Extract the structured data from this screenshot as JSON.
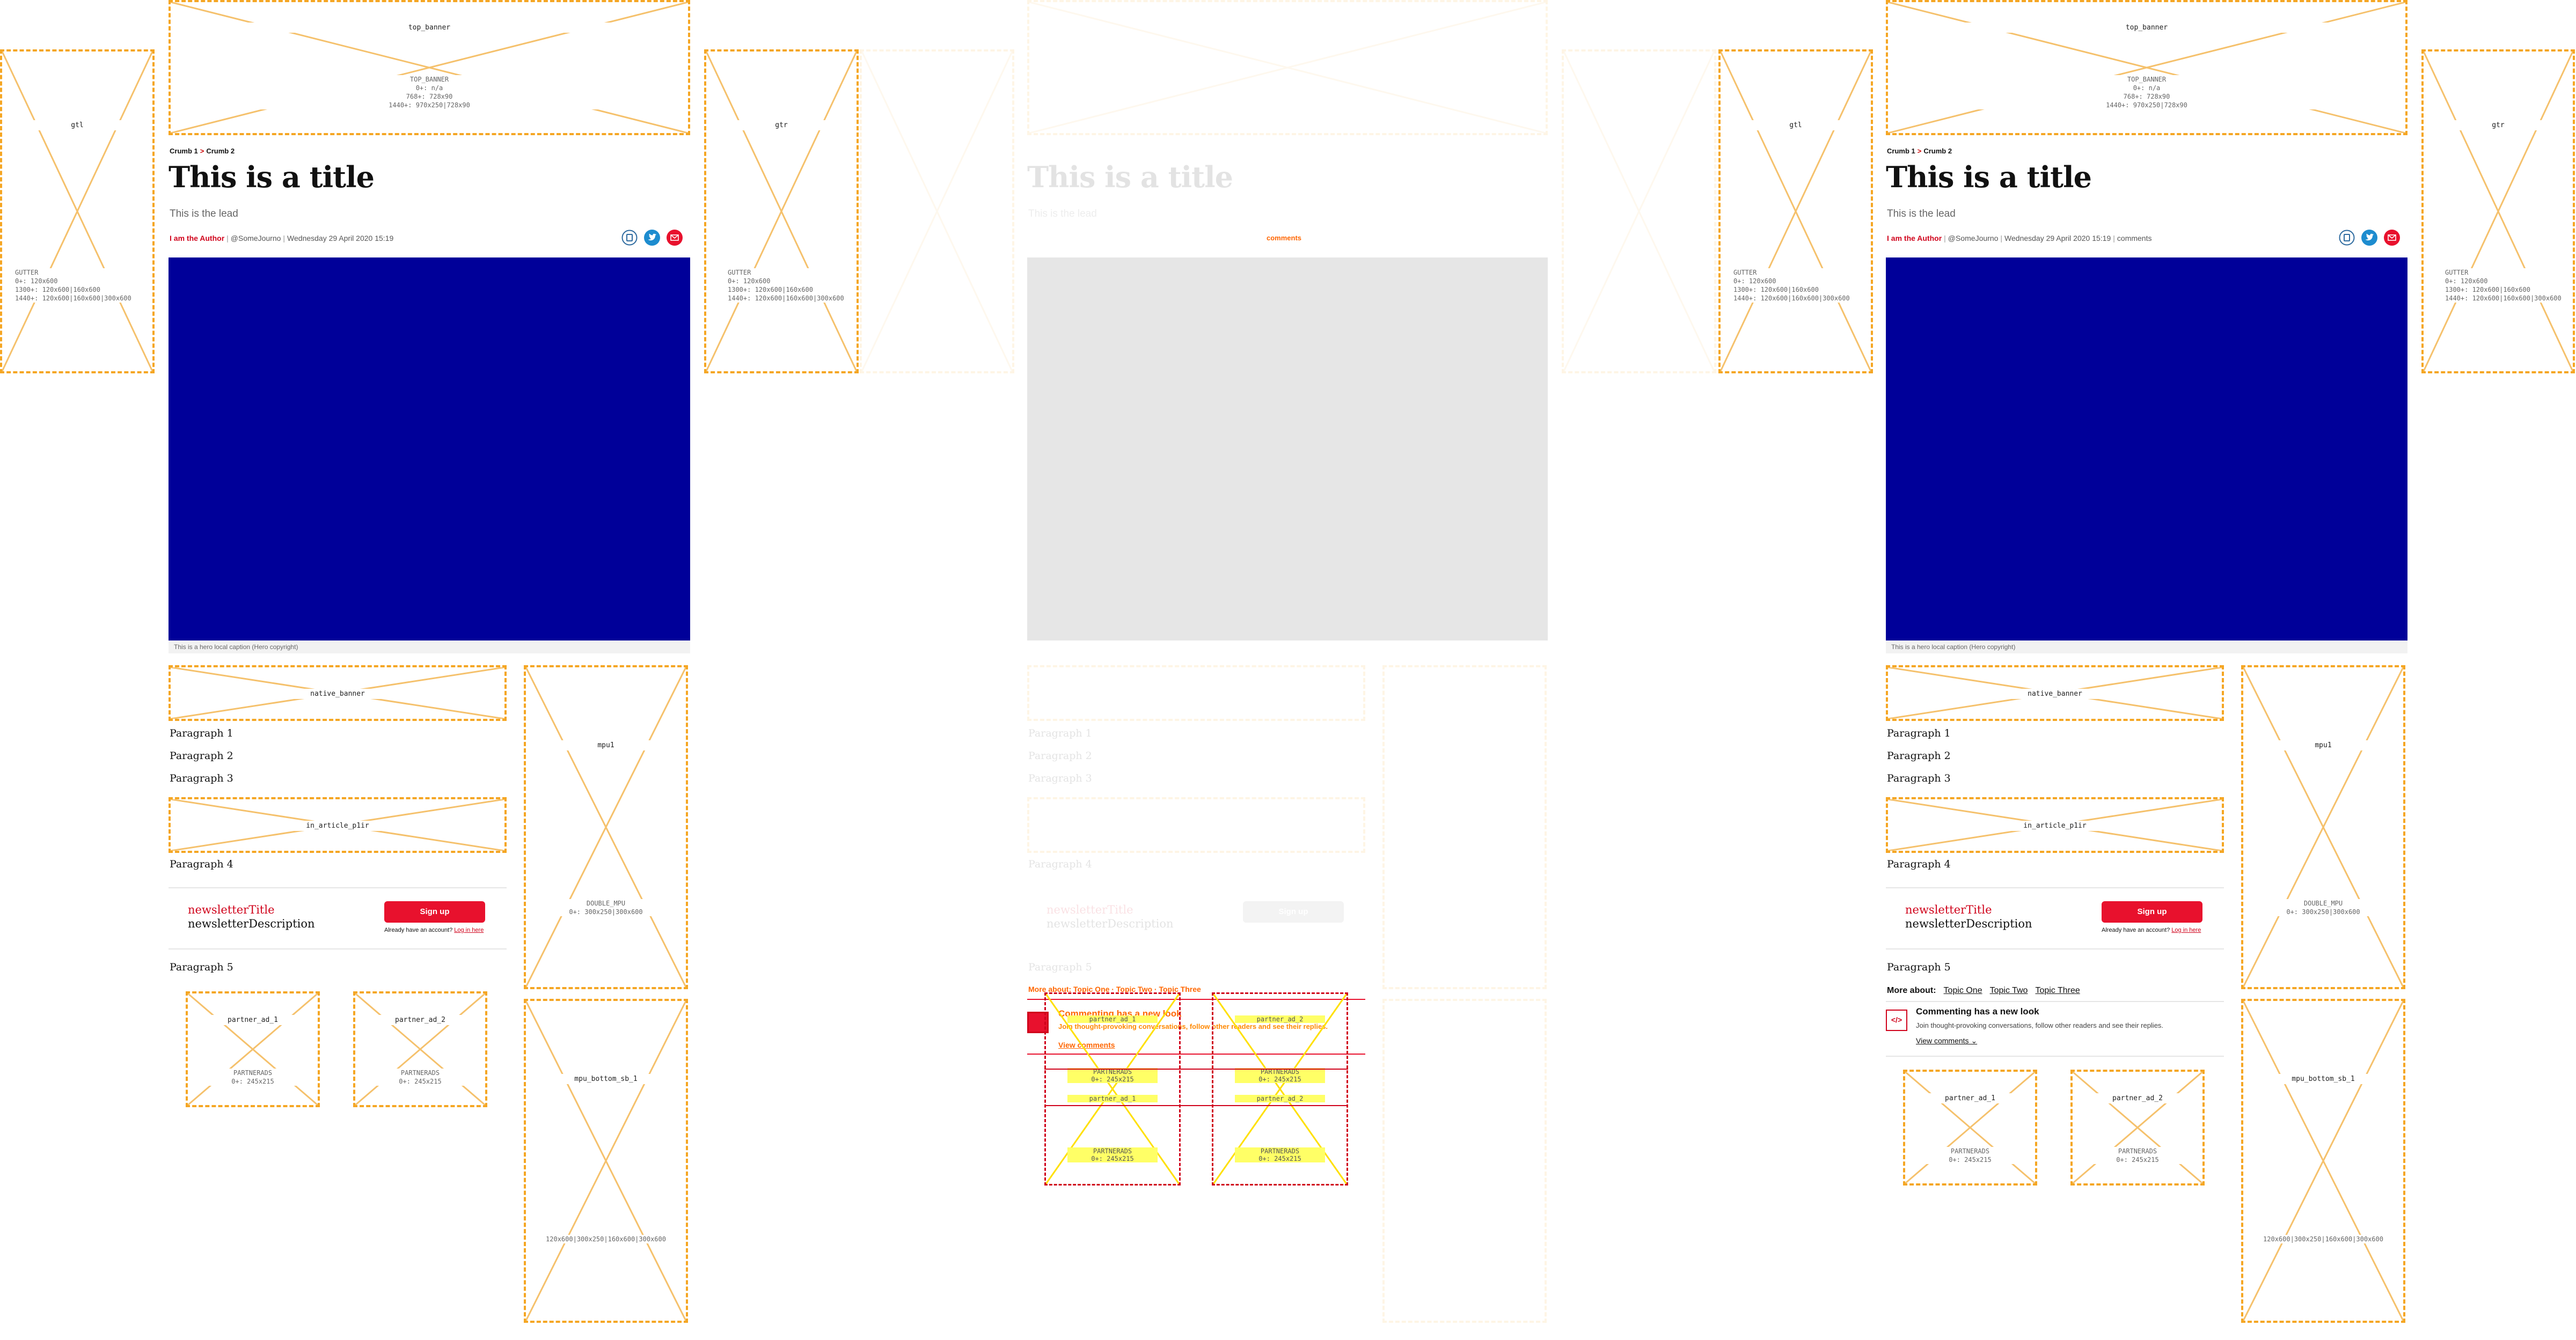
{
  "ads": {
    "top_banner_label": "top_banner",
    "top_banner_meta": "TOP_BANNER\n0+: n/a\n768+: 728x90\n1440+: 970x250|728x90",
    "gutter_left_label": "gtl",
    "gutter_right_label": "gtr",
    "gutter_meta": "GUTTER\n0+: 120x600\n1300+: 120x600|160x600\n1440+: 120x600|160x600|300x600",
    "native_banner_label": "native_banner",
    "in_article_label": "in_article_p1ir",
    "mpu_label": "mpu1",
    "mpu_meta": "DOUBLE_MPU\n0+: 300x250|300x600",
    "mpu_bottom_label": "mpu_bottom_sb_1",
    "mpu_bottom_meta": "120x600|300x250|160x600|300x600",
    "partner_1_label": "partner_ad_1",
    "partner_2_label": "partner_ad_2",
    "partner_meta": "PARTNERADS\n0+: 245x215"
  },
  "article": {
    "crumb_1": "Crumb 1",
    "crumb_sep": ">",
    "crumb_2": "Crumb 2",
    "title": "This is a title",
    "lead": "This is the lead",
    "author": "I am the Author",
    "handle": "@SomeJourno",
    "date": "Wednesday 29 April 2020 15:19",
    "comments_label": "comments",
    "caption": "This is a hero local caption (Hero copyright)",
    "paragraphs": [
      "Paragraph 1",
      "Paragraph 2",
      "Paragraph 3",
      "Paragraph 4",
      "Paragraph 5"
    ]
  },
  "newsletter": {
    "title": "newsletterTitle",
    "description": "newsletterDescription",
    "button": "Sign up",
    "login_text": "Already have an account?",
    "login_link": "Log in here"
  },
  "more_about": {
    "label": "More about:",
    "topics": [
      "Topic One",
      "Topic Two",
      "Topic Three"
    ]
  },
  "comments_promo": {
    "icon": "</>",
    "title": "Commenting has a new look",
    "subtitle": "Join thought-provoking conversations, follow other readers and see their replies.",
    "link": "View comments"
  },
  "colors": {
    "accent": "#d0021b",
    "hero": "#000099",
    "ad_border": "#f5a623"
  }
}
